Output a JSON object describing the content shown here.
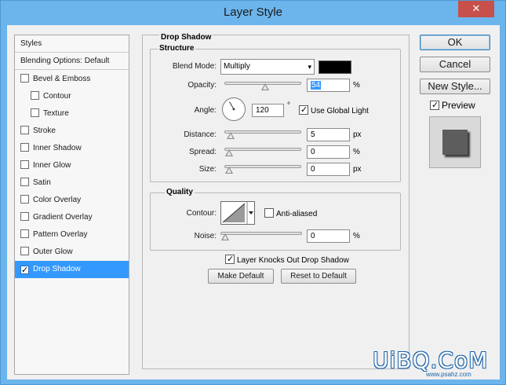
{
  "window": {
    "title": "Layer Style",
    "close_glyph": "✕"
  },
  "sidebar": {
    "items": [
      {
        "label": "Styles",
        "type": "header"
      },
      {
        "label": "Blending Options: Default",
        "type": "header"
      },
      {
        "label": "Bevel & Emboss",
        "checked": false
      },
      {
        "label": "Contour",
        "checked": false,
        "indent": true
      },
      {
        "label": "Texture",
        "checked": false,
        "indent": true
      },
      {
        "label": "Stroke",
        "checked": false
      },
      {
        "label": "Inner Shadow",
        "checked": false
      },
      {
        "label": "Inner Glow",
        "checked": false
      },
      {
        "label": "Satin",
        "checked": false
      },
      {
        "label": "Color Overlay",
        "checked": false
      },
      {
        "label": "Gradient Overlay",
        "checked": false
      },
      {
        "label": "Pattern Overlay",
        "checked": false
      },
      {
        "label": "Outer Glow",
        "checked": false
      },
      {
        "label": "Drop Shadow",
        "checked": true,
        "selected": true
      }
    ]
  },
  "drop_shadow": {
    "section_title": "Drop Shadow",
    "structure": {
      "title": "Structure",
      "blend_mode_label": "Blend Mode:",
      "blend_mode_value": "Multiply",
      "shadow_color": "#000000",
      "opacity_label": "Opacity:",
      "opacity_value": "54",
      "opacity_unit": "%",
      "opacity_level": 0.54,
      "angle_label": "Angle:",
      "angle_value": "120",
      "angle_unit": "°",
      "use_global_light_label": "Use Global Light",
      "use_global_light": true,
      "distance_label": "Distance:",
      "distance_value": "5",
      "distance_unit": "px",
      "distance_level": 0.02,
      "spread_label": "Spread:",
      "spread_value": "0",
      "spread_unit": "%",
      "spread_level": 0,
      "size_label": "Size:",
      "size_value": "0",
      "size_unit": "px",
      "size_level": 0
    },
    "quality": {
      "title": "Quality",
      "contour_label": "Contour:",
      "anti_aliased_label": "Anti-aliased",
      "anti_aliased": false,
      "noise_label": "Noise:",
      "noise_value": "0",
      "noise_unit": "%",
      "noise_level": 0
    },
    "knocks_out_label": "Layer Knocks Out Drop Shadow",
    "knocks_out": true,
    "make_default_label": "Make Default",
    "reset_default_label": "Reset to Default"
  },
  "actions": {
    "ok_label": "OK",
    "cancel_label": "Cancel",
    "new_style_label": "New Style...",
    "preview_label": "Preview",
    "preview_checked": true
  },
  "watermark": {
    "text": "UiBQ.CoM",
    "url": "www.psahz.com"
  }
}
